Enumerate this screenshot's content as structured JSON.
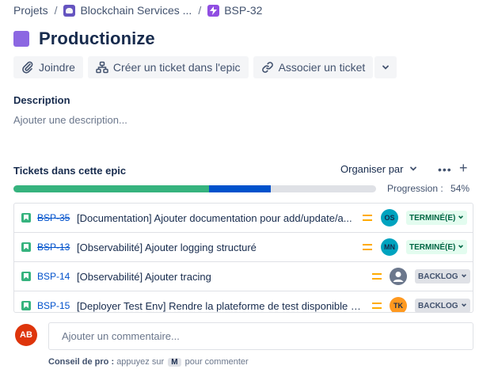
{
  "breadcrumb": {
    "projects": "Projets",
    "sep1": "/",
    "project": "Blockchain Services ...",
    "sep2": "/",
    "issue_key": "BSP-32"
  },
  "title": "Productionize",
  "toolbar": {
    "attach": "Joindre",
    "create_child": "Créer un ticket dans l'epic",
    "link_issue": "Associer un ticket"
  },
  "description": {
    "label": "Description",
    "placeholder": "Ajouter une description..."
  },
  "children": {
    "label": "Tickets dans cette epic",
    "organize": "Organiser par",
    "progress_label": "Progression :",
    "progress_value": "54%",
    "progress_done_fraction": 0.54,
    "progress_inprogress_fraction": 0.17,
    "items": [
      {
        "key": "BSP-35",
        "summary": "[Documentation] Ajouter documentation pour add/update/a...",
        "assignee": "OS",
        "assignee_color": "#00a3bf",
        "status": "TERMINÉ(E)",
        "done": true
      },
      {
        "key": "BSP-13",
        "summary": "[Observabilité] Ajouter logging structuré",
        "assignee": "MN",
        "assignee_color": "#00a3bf",
        "status": "TERMINÉ(E)",
        "done": true
      },
      {
        "key": "BSP-14",
        "summary": "[Observabilité] Ajouter tracing",
        "assignee": "",
        "assignee_color": "#dfe1e6",
        "status": "BACKLOG",
        "done": false
      },
      {
        "key": "BSP-15",
        "summary": "[Deployer Test Env] Rendre la plateforme de test disponible via ...",
        "assignee": "TK",
        "assignee_color": "#ff991f",
        "status": "BACKLOG",
        "done": false
      }
    ]
  },
  "comment": {
    "avatar": "AB",
    "avatar_color": "#de350b",
    "placeholder": "Ajouter un commentaire...",
    "tip_bold": "Conseil de pro :",
    "tip_before": "appuyez sur",
    "tip_key": "M",
    "tip_after": "pour commenter"
  }
}
